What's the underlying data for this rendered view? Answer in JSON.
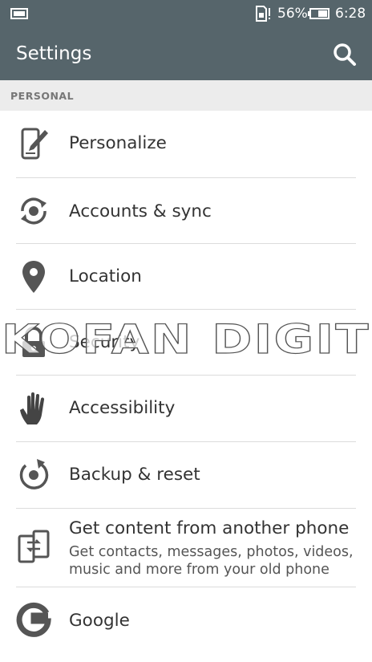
{
  "status_bar": {
    "battery_percent": "56%",
    "time": "6:28"
  },
  "app_bar": {
    "title": "Settings",
    "search_icon": "search-icon"
  },
  "section": {
    "header": "PERSONAL"
  },
  "items": [
    {
      "label": "Personalize",
      "icon": "personalize-icon"
    },
    {
      "label": "Accounts & sync",
      "icon": "sync-icon"
    },
    {
      "label": "Location",
      "icon": "location-pin-icon"
    },
    {
      "label": "Security",
      "icon": "lock-icon"
    },
    {
      "label": "Accessibility",
      "icon": "hand-icon"
    },
    {
      "label": "Backup & reset",
      "icon": "backup-icon"
    },
    {
      "label": "Get content from another phone",
      "subtitle": "Get contacts, messages, photos, videos, music and more from your old phone",
      "icon": "phone-transfer-icon"
    },
    {
      "label": "Google",
      "icon": "google-icon"
    }
  ],
  "watermark": "KOFAN DIGIT",
  "colors": {
    "app_bar": "#56656b",
    "section_bg": "#ececec",
    "icon": "#555555"
  }
}
